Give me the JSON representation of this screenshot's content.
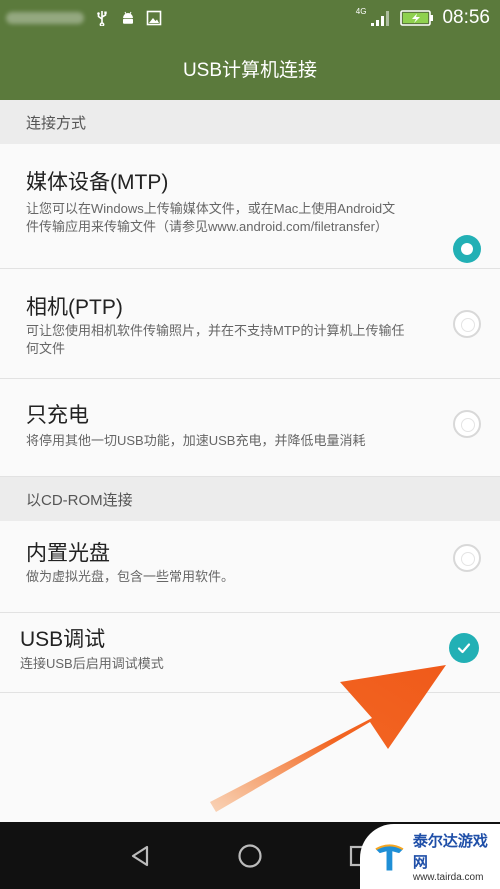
{
  "status_bar": {
    "network_label": "4G",
    "time": "08:56"
  },
  "title": "USB计算机连接",
  "sections": [
    {
      "header": "连接方式",
      "options": [
        {
          "title": "媒体设备(MTP)",
          "desc": "让您可以在Windows上传输媒体文件，或在Mac上使用Android文件传输应用来传输文件（请参见www.android.com/filetransfer）",
          "selected": true
        },
        {
          "title": "相机(PTP)",
          "desc": "可让您使用相机软件传输照片，并在不支持MTP的计算机上传输任何文件",
          "selected": false
        },
        {
          "title": "只充电",
          "desc": "将停用其他一切USB功能，加速USB充电，并降低电量消耗",
          "selected": false
        }
      ]
    },
    {
      "header": "以CD-ROM连接",
      "options": [
        {
          "title": "内置光盘",
          "desc": "做为虚拟光盘，包含一些常用软件。",
          "selected": false
        }
      ]
    }
  ],
  "usb_debug": {
    "title": "USB调试",
    "desc": "连接USB后启用调试模式",
    "checked": true
  },
  "watermark": {
    "name": "泰尔达游戏网",
    "url": "www.tairda.com"
  },
  "colors": {
    "header_green": "#5b7a3c",
    "accent_teal": "#22b0b5",
    "arrow_orange": "#f26522"
  },
  "icons": [
    "usb-icon",
    "android-icon",
    "image-icon",
    "signal-icon",
    "battery-charging-icon",
    "back-icon",
    "home-icon",
    "recents-icon",
    "check-icon"
  ]
}
